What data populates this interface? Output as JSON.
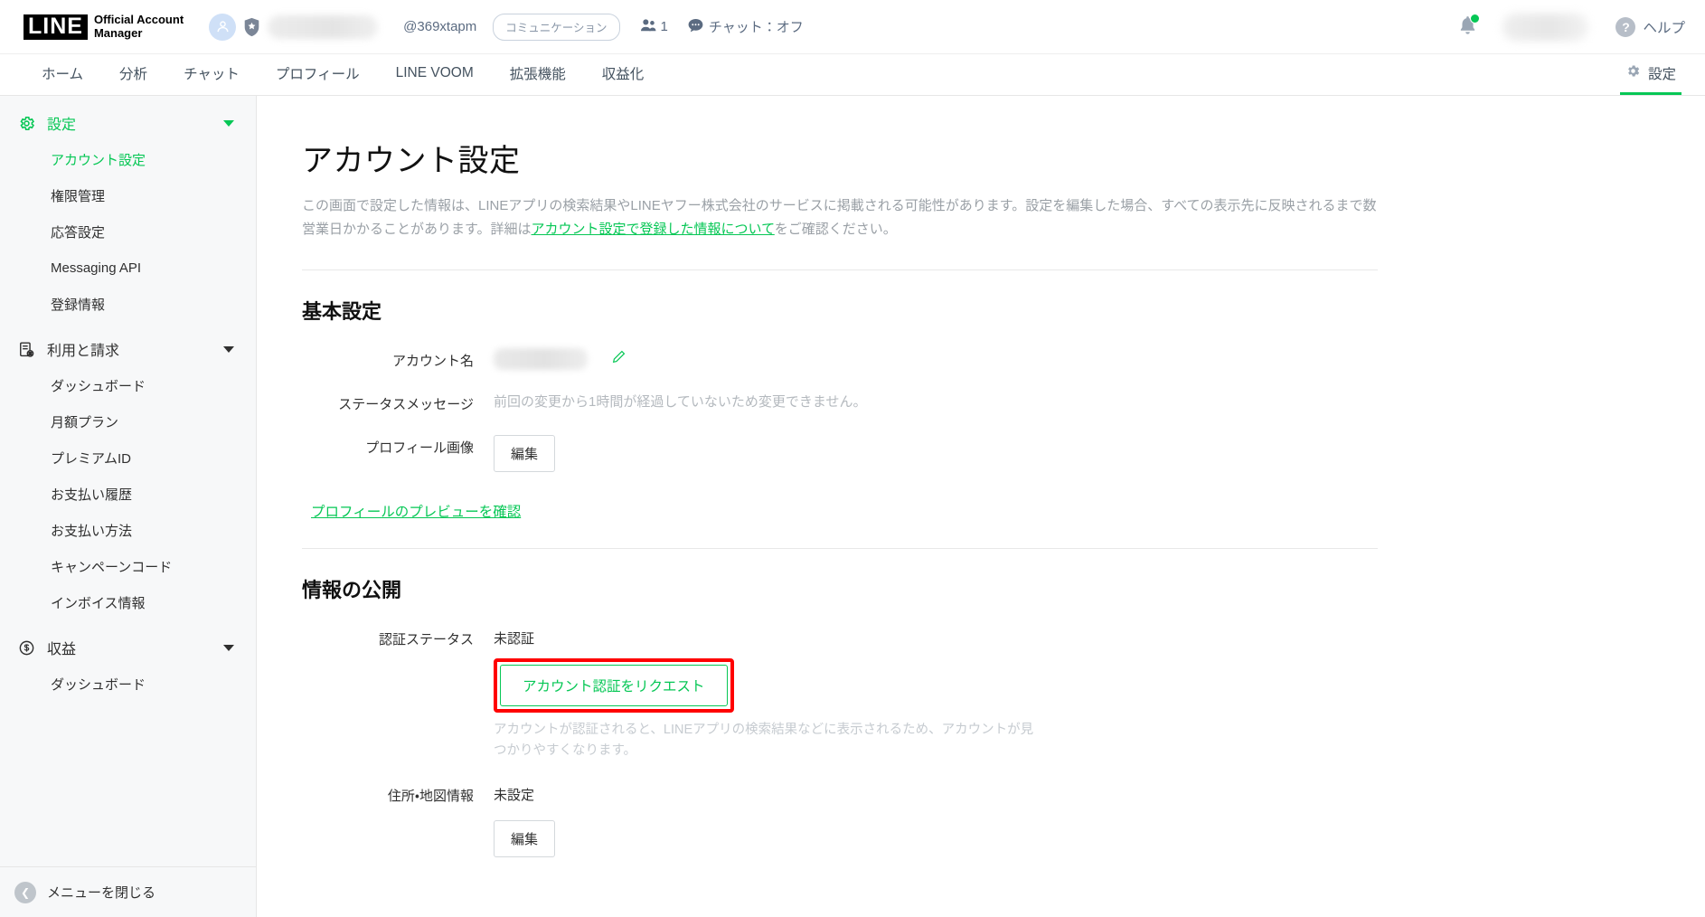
{
  "header": {
    "brand_primary": "LINE",
    "brand_secondary_line1": "Official Account",
    "brand_secondary_line2": "Manager",
    "account_id": "@369xtapm",
    "category_pill": "コミュニケーション",
    "friend_count": "1",
    "chat_status": "チャット：オフ",
    "help_label": "ヘルプ",
    "help_mark": "?",
    "icons": {
      "account_avatar": "person-icon",
      "verified_badge": "shield-star-icon",
      "friends": "friends-icon",
      "chat": "chat-bubble-icon",
      "bell": "bell-icon"
    },
    "notification_dot_color": "#06c755"
  },
  "nav": {
    "items": [
      {
        "label": "ホーム",
        "active": false
      },
      {
        "label": "分析",
        "active": false
      },
      {
        "label": "チャット",
        "active": false
      },
      {
        "label": "プロフィール",
        "active": false
      },
      {
        "label": "LINE VOOM",
        "active": false
      },
      {
        "label": "拡張機能",
        "active": false
      },
      {
        "label": "収益化",
        "active": false
      }
    ],
    "settings_label": "設定",
    "settings_icon": "gear-icon",
    "settings_active": true,
    "active_color": "#06c755"
  },
  "sidebar": {
    "groups": [
      {
        "label": "設定",
        "icon": "gear-icon",
        "active": true,
        "expanded": true,
        "items": [
          {
            "label": "アカウント設定",
            "active": true
          },
          {
            "label": "権限管理",
            "active": false
          },
          {
            "label": "応答設定",
            "active": false
          },
          {
            "label": "Messaging API",
            "active": false
          },
          {
            "label": "登録情報",
            "active": false
          }
        ]
      },
      {
        "label": "利用と請求",
        "icon": "invoice-icon",
        "active": false,
        "expanded": true,
        "items": [
          {
            "label": "ダッシュボード",
            "active": false
          },
          {
            "label": "月額プラン",
            "active": false
          },
          {
            "label": "プレミアムID",
            "active": false
          },
          {
            "label": "お支払い履歴",
            "active": false
          },
          {
            "label": "お支払い方法",
            "active": false
          },
          {
            "label": "キャンペーンコード",
            "active": false
          },
          {
            "label": "インボイス情報",
            "active": false
          }
        ]
      },
      {
        "label": "収益",
        "icon": "dollar-circle-icon",
        "active": false,
        "expanded": true,
        "items": [
          {
            "label": "ダッシュボード",
            "active": false
          }
        ]
      }
    ],
    "footer_label": "メニューを閉じる",
    "footer_icon": "chevron-left-icon"
  },
  "main": {
    "title": "アカウント設定",
    "description_part1": "この画面で設定した情報は、LINEアプリの検索結果やLINEヤフー株式会社のサービスに掲載される可能性があります。設定を編集した場合、すべての表示先に反映されるまで数営業日かかることがあります。詳細は",
    "description_link": "アカウント設定で登録した情報について",
    "description_part2": "をご確認ください。",
    "sections": [
      {
        "title": "基本設定",
        "fields": {
          "account_name_label": "アカウント名",
          "account_name_value_masked": true,
          "account_name_edit_icon": "pencil-icon",
          "status_message_label": "ステータスメッセージ",
          "status_message_value": "前回の変更から1時間が経過していないため変更できません。",
          "profile_image_label": "プロフィール画像",
          "profile_image_button": "編集",
          "profile_preview_link": "プロフィールのプレビューを確認"
        }
      },
      {
        "title": "情報の公開",
        "fields": {
          "auth_status_label": "認証ステータス",
          "auth_status_value": "未認証",
          "auth_request_button": "アカウント認証をリクエスト",
          "auth_help_note": "アカウントが認証されると、LINEアプリの検索結果などに表示されるため、アカウントが見つかりやすくなります。",
          "address_label": "住所・地図情報",
          "address_value": "未設定",
          "address_button": "編集"
        }
      }
    ]
  },
  "colors": {
    "brand_green": "#06c755",
    "highlight_red": "#ff0000",
    "text_primary": "#303030",
    "text_muted": "#9aa0a6"
  }
}
